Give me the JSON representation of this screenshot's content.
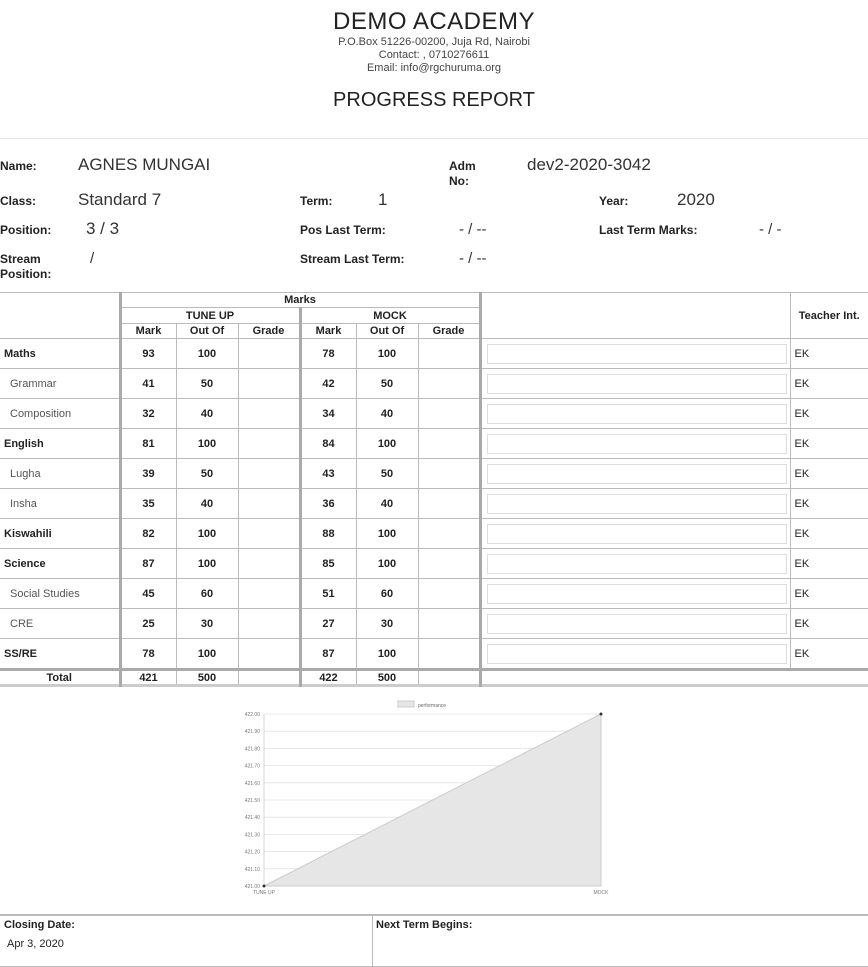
{
  "school": {
    "name": "DEMO ACADEMY",
    "address": "P.O.Box 51226-00200, Juja Rd, Nairobi",
    "contact": "Contact: , 0710276611",
    "email": "Email: info@rgchuruma.org"
  },
  "report_title": "PROGRESS REPORT",
  "student": {
    "name_label": "Name:",
    "name": "AGNES MUNGAI",
    "adm_label": "Adm No:",
    "adm": "dev2-2020-3042",
    "class_label": "Class:",
    "class": "Standard 7",
    "term_label": "Term:",
    "term": "1",
    "year_label": "Year:",
    "year": "2020",
    "position_label": "Position:",
    "position": "3 / 3",
    "pos_last_label": "Pos Last Term:",
    "pos_last": "- / --",
    "last_marks_label": "Last Term Marks:",
    "last_marks": "- / -",
    "stream_pos_label": "Stream Position:",
    "stream_pos": "/",
    "stream_last_label": "Stream Last Term:",
    "stream_last": "- / --"
  },
  "table": {
    "marks_header": "Marks",
    "exam1": "TUNE UP",
    "exam2": "MOCK",
    "col_mark": "Mark",
    "col_outof": "Out Of",
    "col_grade": "Grade",
    "teacher_header": "Teacher Int.",
    "rows": [
      {
        "subject": "Maths",
        "main": true,
        "m1": "93",
        "o1": "100",
        "m2": "78",
        "o2": "100",
        "t": "EK"
      },
      {
        "subject": "Grammar",
        "main": false,
        "m1": "41",
        "o1": "50",
        "m2": "42",
        "o2": "50",
        "t": "EK"
      },
      {
        "subject": "Composition",
        "main": false,
        "m1": "32",
        "o1": "40",
        "m2": "34",
        "o2": "40",
        "t": "EK"
      },
      {
        "subject": "English",
        "main": true,
        "m1": "81",
        "o1": "100",
        "m2": "84",
        "o2": "100",
        "t": "EK"
      },
      {
        "subject": "Lugha",
        "main": false,
        "m1": "39",
        "o1": "50",
        "m2": "43",
        "o2": "50",
        "t": "EK"
      },
      {
        "subject": "Insha",
        "main": false,
        "m1": "35",
        "o1": "40",
        "m2": "36",
        "o2": "40",
        "t": "EK"
      },
      {
        "subject": "Kiswahili",
        "main": true,
        "m1": "82",
        "o1": "100",
        "m2": "88",
        "o2": "100",
        "t": "EK"
      },
      {
        "subject": "Science",
        "main": true,
        "m1": "87",
        "o1": "100",
        "m2": "85",
        "o2": "100",
        "t": "EK"
      },
      {
        "subject": "Social Studies",
        "main": false,
        "m1": "45",
        "o1": "60",
        "m2": "51",
        "o2": "60",
        "t": "EK"
      },
      {
        "subject": "CRE",
        "main": false,
        "m1": "25",
        "o1": "30",
        "m2": "27",
        "o2": "30",
        "t": "EK"
      },
      {
        "subject": "SS/RE",
        "main": true,
        "m1": "78",
        "o1": "100",
        "m2": "87",
        "o2": "100",
        "t": "EK"
      }
    ],
    "total_label": "Total",
    "total": {
      "m1": "421",
      "o1": "500",
      "m2": "422",
      "o2": "500"
    }
  },
  "chart_data": {
    "type": "area",
    "categories": [
      "TUNE UP",
      "MOCK"
    ],
    "series": [
      {
        "name": "performance",
        "values": [
          421,
          422
        ]
      }
    ],
    "ylim": [
      421,
      422
    ],
    "yticks": [
      "422.00",
      "421.90",
      "421.80",
      "421.70",
      "421.60",
      "421.50",
      "421.40",
      "421.30",
      "421.20",
      "421.10",
      "421.00"
    ],
    "grid": true,
    "legend": "top",
    "fill_color": "#e6e6e6",
    "line_color": "#cccccc"
  },
  "footer": {
    "closing_label": "Closing Date:",
    "closing_date": "Apr 3, 2020",
    "next_term_label": "Next Term Begins:"
  }
}
